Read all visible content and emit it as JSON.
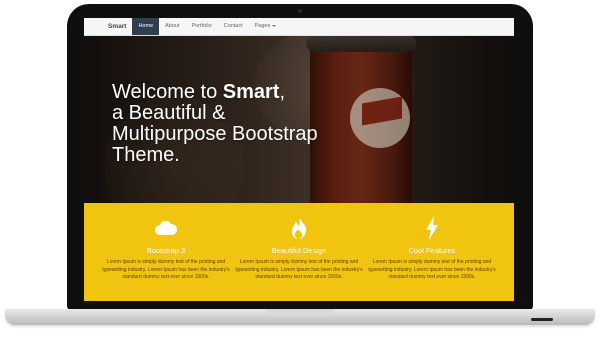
{
  "navbar": {
    "brand": "Smart",
    "items": [
      {
        "label": "Home",
        "active": true
      },
      {
        "label": "About",
        "active": false
      },
      {
        "label": "Portfolio",
        "active": false
      },
      {
        "label": "Contact",
        "active": false
      },
      {
        "label": "Pages",
        "active": false,
        "dropdown": true
      }
    ]
  },
  "hero": {
    "line1_pre": "Welcome to ",
    "line1_brand": "Smart",
    "line1_post": ",",
    "line2": "a Beautiful &",
    "line3": "Multipurpose Bootstrap",
    "line4": "Theme."
  },
  "features": [
    {
      "icon": "cloud-icon",
      "title": "Bootstrap 3",
      "text": "Lorem Ipsum is simply dummy text of the printing and typesetting industry. Lorem Ipsum has been the industry's standard dummy text ever since 1500s."
    },
    {
      "icon": "fire-icon",
      "title": "Beautiful Design",
      "text": "Lorem Ipsum is simply dummy text of the printing and typesetting industry. Lorem Ipsum has been the industry's standard dummy text ever since 1500s."
    },
    {
      "icon": "bolt-icon",
      "title": "Cool Features",
      "text": "Lorem Ipsum is simply dummy text of the printing and typesetting industry. Lorem Ipsum has been the industry's standard dummy text ever since 1500s."
    }
  ],
  "colors": {
    "nav_active": "#2e3f50",
    "feature_bg": "#f1c40f"
  }
}
